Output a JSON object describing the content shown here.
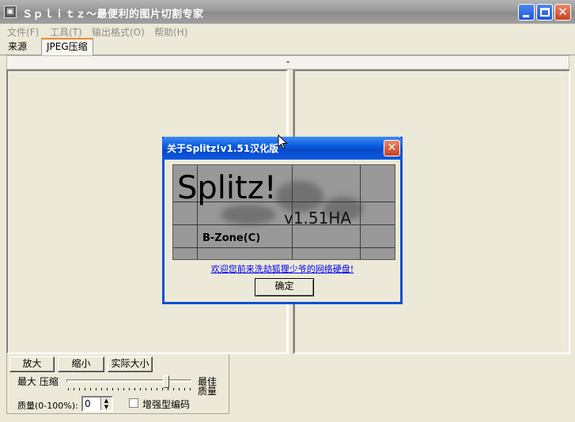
{
  "window": {
    "title": "Ｓｐｌｉｔｚ～最便利的图片切割专家"
  },
  "menubar": {
    "items": [
      "文件(F)",
      "工具(T)",
      "输出格式(O)",
      "帮助(H)"
    ]
  },
  "tabs": [
    {
      "label": "来源",
      "selected": false
    },
    {
      "label": "JPEG压缩",
      "selected": true
    }
  ],
  "divider_bar": {
    "label": "-"
  },
  "buttons": {
    "zoom_in": "放大",
    "zoom_out": "缩小",
    "actual_size": "实际大小"
  },
  "compression": {
    "left_label": "最大 压缩",
    "right_label_1": "最佳",
    "right_label_2": "质量",
    "quality_label": "质量(0-100%):",
    "quality_value": "0",
    "enhanced_label": "增强型编码",
    "enhanced_checked": false
  },
  "about_dialog": {
    "title": "关于Splitz!v1.51汉化版",
    "logo_text": "Splitz!",
    "version_text": "v1.51HA",
    "company_text": "B-Zone(C)",
    "link_text": "欢迎您前来洗劫狐狸少爷的网络硬盘!",
    "ok_label": "确定"
  },
  "colors": {
    "dialog_title": "#0a5ce0",
    "link": "#0000ee",
    "inactive_title": "#999999"
  }
}
